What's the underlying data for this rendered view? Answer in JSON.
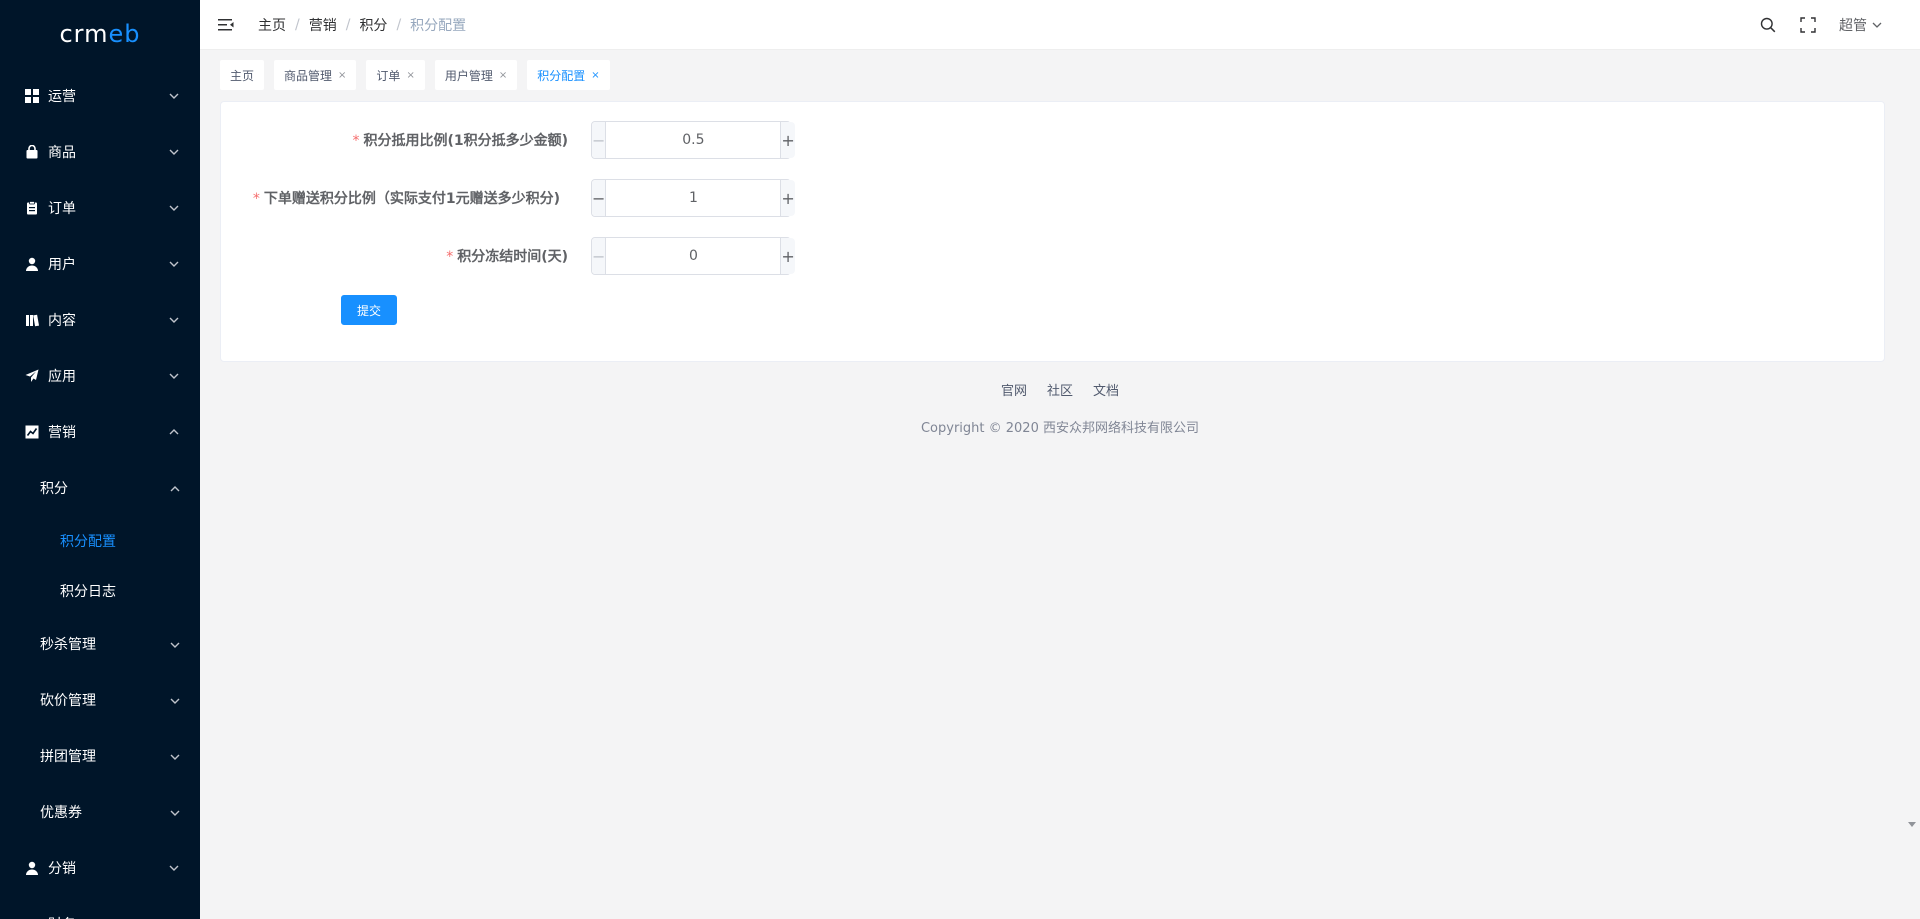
{
  "app": {
    "logo_text_a": "crm",
    "logo_text_b": "eb"
  },
  "sidebar": {
    "items": [
      {
        "label": "运营",
        "icon": "grid-icon"
      },
      {
        "label": "商品",
        "icon": "bag-icon"
      },
      {
        "label": "订单",
        "icon": "clipboard-icon"
      },
      {
        "label": "用户",
        "icon": "user-icon"
      },
      {
        "label": "内容",
        "icon": "book-icon"
      },
      {
        "label": "应用",
        "icon": "paper-plane-icon"
      },
      {
        "label": "营销",
        "icon": "trend-chart-icon",
        "expanded": true
      }
    ],
    "marketing_sub": [
      {
        "label": "积分",
        "expanded": true
      },
      {
        "label": "秒杀管理"
      },
      {
        "label": "砍价管理"
      },
      {
        "label": "拼团管理"
      },
      {
        "label": "优惠券"
      }
    ],
    "points_leaves": [
      {
        "label": "积分配置",
        "active": true
      },
      {
        "label": "积分日志"
      }
    ],
    "after_items": [
      {
        "label": "分销",
        "icon": "user-icon"
      },
      {
        "label": "财务",
        "icon": "wallet-icon"
      }
    ]
  },
  "header": {
    "breadcrumb": [
      "主页",
      "营销",
      "积分",
      "积分配置"
    ],
    "user_name": "超管"
  },
  "tags": [
    {
      "label": "主页",
      "closable": false,
      "active": false
    },
    {
      "label": "商品管理",
      "closable": true,
      "active": false
    },
    {
      "label": "订单",
      "closable": true,
      "active": false
    },
    {
      "label": "用户管理",
      "closable": true,
      "active": false
    },
    {
      "label": "积分配置",
      "closable": true,
      "active": true
    }
  ],
  "form": {
    "fields": [
      {
        "label": "积分抵用比例(1积分抵多少金额)",
        "value": "0.5",
        "minus_disabled": true
      },
      {
        "label": "下单赠送积分比例（实际支付1元赠送多少积分)",
        "value": "1",
        "minus_disabled": false
      },
      {
        "label": "积分冻结时间(天)",
        "value": "0",
        "minus_disabled": true
      }
    ],
    "submit_label": "提交",
    "required_mark": "*"
  },
  "footer": {
    "links": [
      "官网",
      "社区",
      "文档"
    ],
    "copyright": "Copyright © 2020 西安众邦网络科技有限公司"
  },
  "colors": {
    "sidebar_bg": "#001529",
    "accent": "#1890ff",
    "required": "#f56c6c"
  }
}
